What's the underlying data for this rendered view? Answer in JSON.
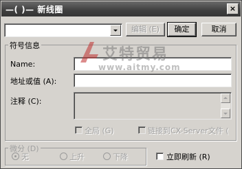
{
  "window": {
    "title": "—(  )—  新线圈",
    "close_glyph": "×"
  },
  "toolbar": {
    "combo_value": "",
    "edit_label": "编辑 (E)",
    "ok_label": "确定",
    "cancel_label": "取消"
  },
  "symbol_info": {
    "group_label": "符号信息",
    "name_label": "Name:",
    "name_value": "",
    "address_label": "地址或值 (A):",
    "address_value": "",
    "comment_label": "注释 (C):",
    "comment_value": "",
    "global_label": "全局 (G)",
    "link_label": "链接到CX-Server文件 (",
    "global_checked": false,
    "link_checked": false
  },
  "differential": {
    "group_label": "微分 (D)",
    "options": [
      "无",
      "上升",
      "下降"
    ],
    "selected_index": 0
  },
  "refresh": {
    "label": "立即刷新 (R)",
    "checked": false
  },
  "watermark": {
    "brand": "艾特贸易",
    "url": "www.aitmy.com"
  },
  "colors": {
    "dialog_bg": "#d6d3ce",
    "titlebar": "#3f3f3f"
  }
}
